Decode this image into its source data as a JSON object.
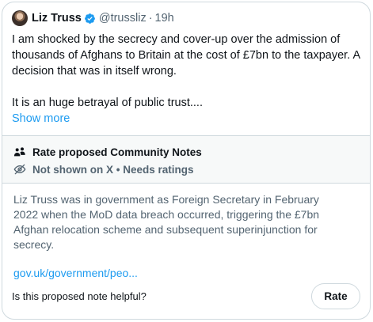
{
  "tweet": {
    "author_name": "Liz Truss",
    "handle": "@trussliz",
    "separator": "·",
    "time": "19h",
    "paragraph1": "I am shocked by the secrecy and cover-up over the admission of thousands of Afghans to Britain at the cost of £7bn to the taxpayer. A decision that was in itself wrong.",
    "paragraph2": "It is an huge betrayal of public trust....",
    "show_more": "Show more"
  },
  "community_notes": {
    "title": "Rate proposed Community Notes",
    "status": "Not shown on X • Needs ratings",
    "note_text": "Liz Truss was in government as Foreign Secretary in February 2022 when the MoD data breach occurred, triggering the £7bn Afghan relocation scheme and subsequent superinjunction for secrecy.",
    "link": "gov.uk/government/peo...",
    "helpful_question": "Is this proposed note helpful?",
    "rate_label": "Rate"
  },
  "colors": {
    "accent": "#1d9bf0",
    "text": "#0f1419",
    "muted": "#536471",
    "border": "#cfd9de",
    "cn_bg": "#f7f9f9"
  },
  "icons": [
    "avatar",
    "verified-badge-icon",
    "people-icon",
    "eye-off-icon"
  ]
}
